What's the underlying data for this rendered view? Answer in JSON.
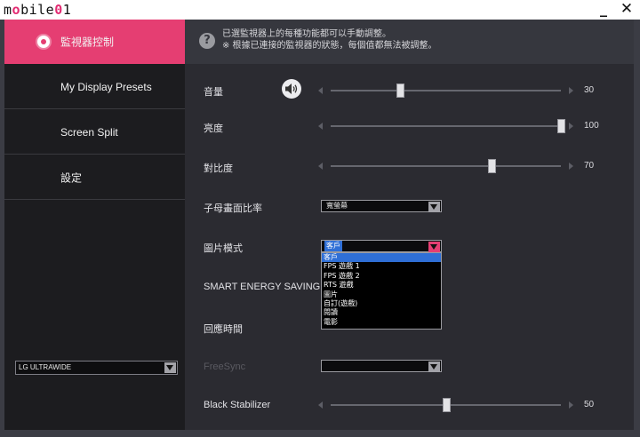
{
  "titlebar": {
    "logo_letters": [
      "m",
      "o",
      "b",
      "i",
      "l",
      "e",
      "0",
      "1"
    ],
    "minimize_label": "_",
    "close_label": "✕"
  },
  "sidebar": {
    "items": [
      {
        "label": "監視器控制",
        "active": true
      },
      {
        "label": "My Display Presets",
        "active": false
      },
      {
        "label": "Screen Split",
        "active": false
      },
      {
        "label": "設定",
        "active": false
      }
    ],
    "monitor_select": {
      "value": "LG ULTRAWIDE"
    }
  },
  "info": {
    "line1": "已選監視器上的每種功能都可以手動調整。",
    "line2": "※ 根據已連接的監視器的狀態，每個值都無法被調整。",
    "help_icon_label": "?"
  },
  "settings": {
    "volume": {
      "label": "音量",
      "value": "30",
      "level": 0.3
    },
    "brightness": {
      "label": "亮度",
      "value": "100",
      "level": 1.0
    },
    "contrast": {
      "label": "對比度",
      "value": "70",
      "level": 0.7
    },
    "aspect_ratio": {
      "label": "子母畫面比率",
      "value": "寬螢幕"
    },
    "picture_mode": {
      "label": "圖片模式",
      "value": "客戶",
      "options": [
        "客戶",
        "FPS 遊戲 1",
        "FPS 遊戲 2",
        "RTS 遊戲",
        "圖片",
        "自訂(遊戲)",
        "閱讀",
        "電影"
      ],
      "highlighted_index": 0
    },
    "smart_energy": {
      "label": "SMART ENERGY SAVING"
    },
    "response_time": {
      "label": "回應時間"
    },
    "freesync": {
      "label": "FreeSync",
      "value": ""
    },
    "black_stabilizer": {
      "label": "Black Stabilizer",
      "value": "50",
      "level": 0.5
    }
  },
  "colors": {
    "accent": "#e53e72",
    "sidebar_bg": "#1c1c1f",
    "content_bg": "#2b2b31",
    "selection": "#2f6fd6"
  },
  "icons": [
    "speaker-icon",
    "help-icon",
    "radio-icon",
    "chevron-down-icon",
    "minimize-icon",
    "close-icon"
  ]
}
